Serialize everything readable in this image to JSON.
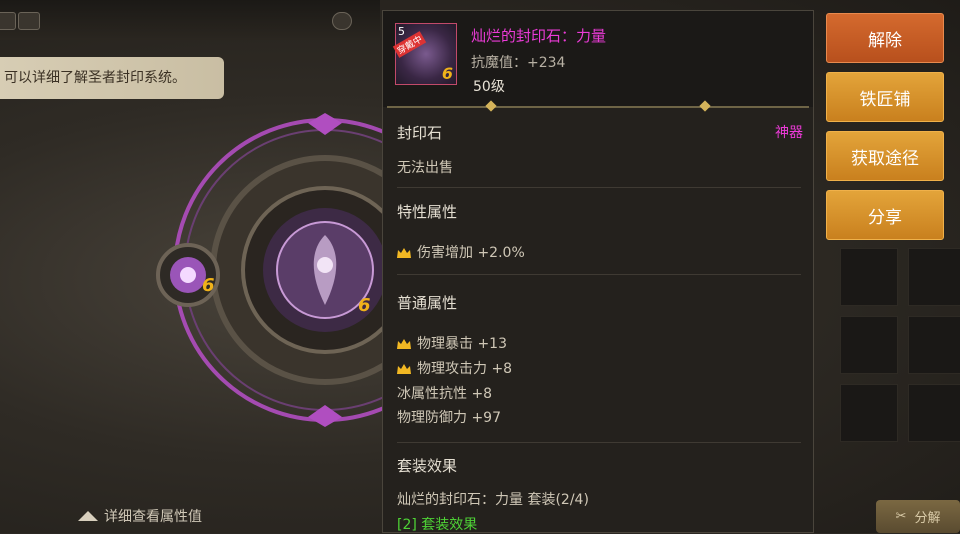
{
  "notice": {
    "text": "可以详细了解圣者封印系统。"
  },
  "bottom_link": {
    "label": "详细查看属性值"
  },
  "item": {
    "icon_level": "5",
    "icon_tag": "穿戴中",
    "icon_grade": "6",
    "name": "灿烂的封印石：力量",
    "magic_resist": "抗魔值：+234",
    "level": "50级",
    "type": "封印石",
    "rarity": "神器",
    "sell": "无法出售"
  },
  "special_attrs": {
    "title": "特性属性",
    "items": [
      "伤害增加 +2.0%"
    ]
  },
  "normal_attrs": {
    "title": "普通属性",
    "items": [
      {
        "text": "物理暴击 +13",
        "crown": true
      },
      {
        "text": "物理攻击力 +8",
        "crown": true
      },
      {
        "text": "冰属性抗性 +8",
        "crown": false
      },
      {
        "text": "物理防御力 +97",
        "crown": false
      }
    ]
  },
  "set_effect": {
    "title": "套装效果",
    "set_name": "灿烂的封印石：力量  套装(2/4)",
    "bonus": "[2] 套装效果"
  },
  "buttons": {
    "remove": "解除",
    "blacksmith": "铁匠铺",
    "source": "获取途径",
    "share": "分享"
  },
  "decompose": {
    "label": "分解"
  },
  "slot_grade": "6",
  "colors": {
    "artifact": "#ec3bd8",
    "set_bonus": "#4ed236",
    "gold": "#e3a43a"
  }
}
